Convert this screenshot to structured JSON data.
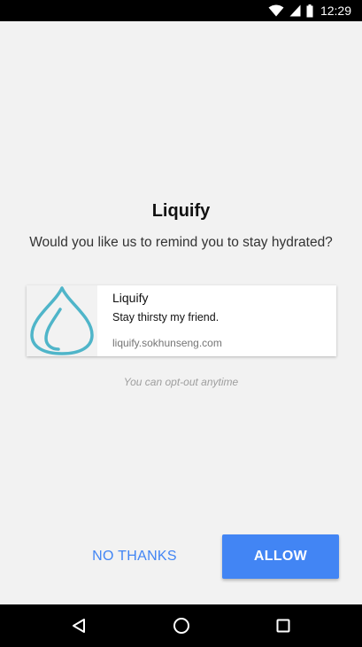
{
  "status_bar": {
    "time": "12:29",
    "icons": [
      "wifi-icon",
      "cell-signal-icon",
      "battery-icon"
    ]
  },
  "dialog": {
    "title": "Liquify",
    "question": "Would you like us to remind you to stay hydrated?",
    "notification_preview": {
      "icon": "water-drop-icon",
      "title": "Liquify",
      "body": "Stay thirsty my friend.",
      "url": "liquify.sokhunseng.com"
    },
    "optout_note": "You can opt-out anytime",
    "buttons": {
      "no_thanks": "NO THANKS",
      "allow": "ALLOW"
    }
  },
  "nav_bar": {
    "icons": [
      "back-icon",
      "home-icon",
      "recents-icon"
    ]
  },
  "colors": {
    "accent": "#4285f4",
    "drop": "#4fb5c9",
    "background": "#f2f2f2"
  }
}
